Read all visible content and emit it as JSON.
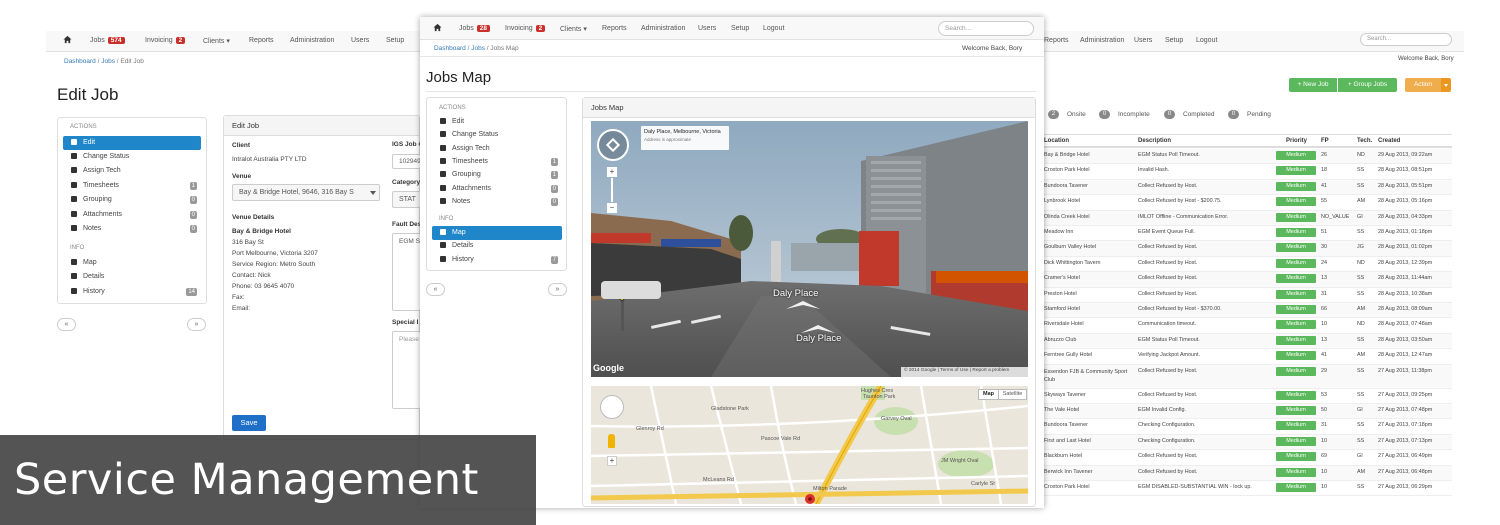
{
  "left": {
    "nav": {
      "jobs": "Jobs",
      "jobs_count": "574",
      "invoicing": "Invoicing",
      "invoicing_count": "2",
      "clients": "Clients",
      "reports": "Reports",
      "administration": "Administration",
      "users": "Users",
      "setup": "Setup"
    },
    "breadcrumb": {
      "home": "Dashboard",
      "jobs": "Jobs",
      "current": "Edit Job"
    },
    "page_title": "Edit Job",
    "sidebar": {
      "actions_head": "ACTIONS",
      "edit": "Edit",
      "change_status": "Change Status",
      "assign_tech": "Assign Tech",
      "timesheets": "Timesheets",
      "timesheets_count": "1",
      "grouping": "Grouping",
      "grouping_count": "0",
      "attachments": "Attachments",
      "attachments_count": "0",
      "notes": "Notes",
      "notes_count": "0",
      "info_head": "INFO",
      "map": "Map",
      "details": "Details",
      "history": "History",
      "history_count": "14",
      "prev": "«",
      "next": "»"
    },
    "form": {
      "panel_title": "Edit Job",
      "client_label": "Client",
      "client_value": "Intralot Australia PTY LTD",
      "venue_label": "Venue",
      "venue_value": "Bay & Bridge Hotel, 9646, 316 Bay S",
      "venue_details_label": "Venue Details",
      "venue_name": "Bay & Bridge Hotel",
      "addr1": "316 Bay St",
      "addr2": "Port Melbourne, Victoria 3207",
      "region": "Service Region: Metro South",
      "contact": "Contact: Nick",
      "phone": "Phone: 03 9645 4070",
      "fax": "Fax:",
      "email": "Email:",
      "igs_label": "IGS Job #",
      "igs_value": "102949",
      "category_label": "Category",
      "category_value": "STAT",
      "fault_label": "Fault Des",
      "fault_value": "EGM St",
      "special_label": "Special I",
      "special_placeholder": "Please",
      "save": "Save"
    }
  },
  "middle": {
    "nav": {
      "jobs": "Jobs",
      "jobs_count": "28",
      "invoicing": "Invoicing",
      "invoicing_count": "2",
      "clients": "Clients",
      "reports": "Reports",
      "administration": "Administration",
      "users": "Users",
      "setup": "Setup",
      "logout": "Logout",
      "search_placeholder": "Search..."
    },
    "breadcrumb": {
      "home": "Dashboard",
      "jobs": "Jobs",
      "current": "Jobs Map"
    },
    "welcome": "Welcome Back, Bory",
    "page_title": "Jobs Map",
    "sidebar": {
      "actions_head": "ACTIONS",
      "edit": "Edit",
      "change_status": "Change Status",
      "assign_tech": "Assign Tech",
      "timesheets": "Timesheets",
      "timesheets_count": "1",
      "grouping": "Grouping",
      "grouping_count": "1",
      "attachments": "Attachments",
      "attachments_count": "0",
      "notes": "Notes",
      "notes_count": "0",
      "info_head": "INFO",
      "map": "Map",
      "details": "Details",
      "history": "History",
      "history_count": "7",
      "prev": "«",
      "next": "»"
    },
    "map_panel": {
      "title": "Jobs Map",
      "streetview_place": "Daly Place, Melbourne, Victoria",
      "streetview_note": "Address is approximate",
      "street_label_1": "Daly Place",
      "street_label_2": "Daly Place",
      "google": "Google",
      "copyright": "© 2014 Google",
      "terms": "Terms of Use",
      "report": "Report a problem",
      "map_btn": "Map",
      "satellite_btn": "Satellite",
      "map_labels": [
        "Hughes Cres",
        "Taunton Park",
        "Garvey Oval",
        "Glenroy Rd",
        "McLeans Rd",
        "Pascoe Vale Rd",
        "JM Wright Oval",
        "Milton Parade",
        "Carlyle St",
        "Gladstone Park"
      ]
    }
  },
  "right": {
    "nav": {
      "reports": "Reports",
      "administration": "Administration",
      "users": "Users",
      "setup": "Setup",
      "logout": "Logout",
      "search_placeholder": "Search..."
    },
    "welcome": "Welcome Back, Bory",
    "buttons": {
      "new_job": "+ New Job",
      "group_jobs": "+ Group Jobs",
      "action": "Action"
    },
    "filters": [
      {
        "count": "2",
        "label": "Onsite"
      },
      {
        "count": "0",
        "label": "Incomplete"
      },
      {
        "count": "0",
        "label": "Completed"
      },
      {
        "count": "0",
        "label": "Pending"
      }
    ],
    "columns": [
      "Location",
      "Description",
      "Priority",
      "FP",
      "Tech.",
      "Created"
    ],
    "rows": [
      [
        "Bay & Bridge Hotel",
        "EGM Status Poll Timeout.",
        "Medium",
        "26",
        "ND",
        "29 Aug 2013, 09:22am"
      ],
      [
        "Croxton Park Hotel",
        "Invalid Hash.",
        "Medium",
        "18",
        "SS",
        "28 Aug 2013, 08:51pm"
      ],
      [
        "Bundoora Tavener",
        "Collect Refused by Host.",
        "Medium",
        "41",
        "SS",
        "28 Aug 2013, 05:51pm"
      ],
      [
        "Lynbrook Hotel",
        "Collect Refused by Host - $200.75.",
        "Medium",
        "55",
        "AM",
        "28 Aug 2013, 05:16pm"
      ],
      [
        "Olinda Creek Hotel",
        "IMLOT Offline - Communication Error.",
        "Medium",
        "NO_VALUE",
        "GI",
        "28 Aug 2013, 04:33pm"
      ],
      [
        "Meadow Inn",
        "EGM Event Queue Full.",
        "Medium",
        "51",
        "SS",
        "28 Aug 2013, 01:18pm"
      ],
      [
        "Goulburn Valley Hotel",
        "Collect Refused by Host.",
        "Medium",
        "30",
        "JG",
        "28 Aug 2013, 01:02pm"
      ],
      [
        "Dick Whittington Tavern",
        "Collect Refused by Host.",
        "Medium",
        "24",
        "ND",
        "28 Aug 2013, 12:39pm"
      ],
      [
        "Cramer's Hotel",
        "Collect Refused by Host.",
        "Medium",
        "13",
        "SS",
        "28 Aug 2013, 11:44am"
      ],
      [
        "Preston Hotel",
        "Collect Refused by Host.",
        "Medium",
        "31",
        "SS",
        "28 Aug 2013, 10:38am"
      ],
      [
        "Stamford Hotel",
        "Collect Refused by Host - $370.00.",
        "Medium",
        "66",
        "AM",
        "28 Aug 2013, 08:09am"
      ],
      [
        "Riversdale Hotel",
        "Communication timeout.",
        "Medium",
        "10",
        "ND",
        "28 Aug 2013, 07:48am"
      ],
      [
        "Abruzzo Club",
        "EGM Status Poll Timeout.",
        "Medium",
        "13",
        "SS",
        "28 Aug 2013, 03:50am"
      ],
      [
        "Ferntree Gully Hotel",
        "Verifying Jackpot Amount.",
        "Medium",
        "41",
        "AM",
        "28 Aug 2013, 12:47am"
      ],
      [
        "Essendon FJB & Community Sport Club",
        "Collect Refused by Host.",
        "Medium",
        "29",
        "SS",
        "27 Aug 2013, 11:38pm"
      ],
      [
        "Skyways Tavener",
        "Collect Refused by Host.",
        "Medium",
        "53",
        "SS",
        "27 Aug 2013, 09:25pm"
      ],
      [
        "The Vale Hotel",
        "EGM Invalid Config.",
        "Medium",
        "50",
        "GI",
        "27 Aug 2013, 07:48pm"
      ],
      [
        "Bundoora Tavener",
        "Checking Configuration.",
        "Medium",
        "31",
        "SS",
        "27 Aug 2013, 07:18pm"
      ],
      [
        "First and Last Hotel",
        "Checking Configuration.",
        "Medium",
        "10",
        "SS",
        "27 Aug 2013, 07:13pm"
      ],
      [
        "Blackburn Hotel",
        "Collect Refused by Host.",
        "Medium",
        "69",
        "GI",
        "27 Aug 2013, 06:49pm"
      ],
      [
        "Berwick Inn Tavener",
        "Collect Refused by Host.",
        "Medium",
        "10",
        "AM",
        "27 Aug 2013, 06:48pm"
      ],
      [
        "Croxton Park Hotel",
        "EGM DISABLED-SUBSTANTIAL WIN - lock up.",
        "Medium",
        "10",
        "SS",
        "27 Aug 2013, 06:29pm"
      ]
    ]
  },
  "caption": "Service Management",
  "colors": {
    "accent": "#1f86c9",
    "success": "#5cb85c",
    "warning": "#f0ad4e",
    "danger": "#c9302c"
  }
}
